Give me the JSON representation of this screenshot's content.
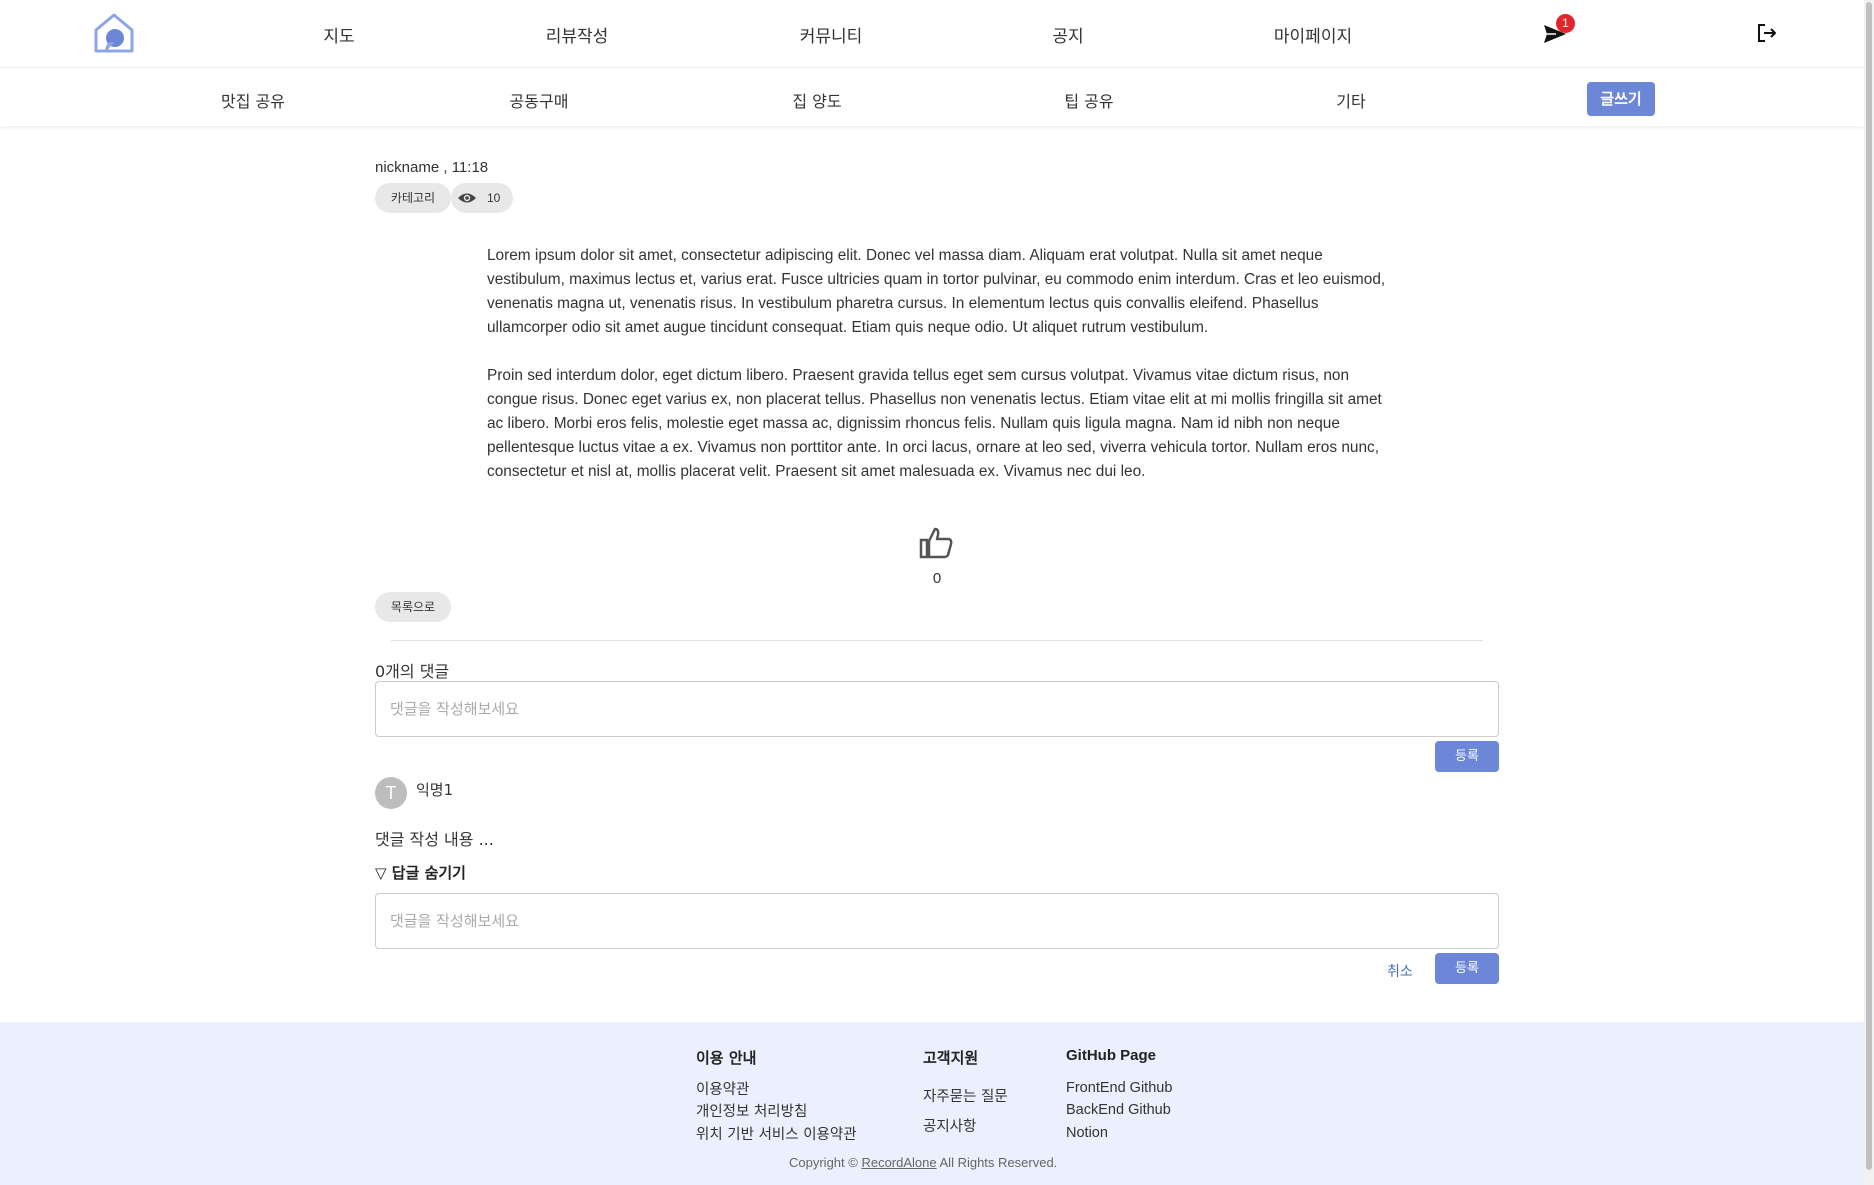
{
  "topnav": {
    "items": [
      {
        "label": "지도"
      },
      {
        "label": "리뷰작성"
      },
      {
        "label": "커뮤니티"
      },
      {
        "label": "공지"
      },
      {
        "label": "마이페이지"
      }
    ],
    "notification_count": "1"
  },
  "subnav": {
    "categories": [
      {
        "label": "맛집 공유"
      },
      {
        "label": "공동구매"
      },
      {
        "label": "집 양도"
      },
      {
        "label": "팁 공유"
      },
      {
        "label": "기타"
      }
    ],
    "write_label": "글쓰기"
  },
  "post": {
    "meta": "nickname , 11:18",
    "category_label": "카테고리",
    "views": "10",
    "paragraphs": [
      "Lorem ipsum dolor sit amet, consectetur adipiscing elit. Donec vel massa diam. Aliquam erat volutpat. Nulla sit amet neque vestibulum, maximus lectus et, varius erat. Fusce ultricies quam in tortor pulvinar, eu commodo enim interdum. Cras et leo euismod, venenatis magna ut, venenatis risus. In vestibulum pharetra cursus. In elementum lectus quis convallis eleifend. Phasellus ullamcorper odio sit amet augue tincidunt consequat. Etiam quis neque odio. Ut aliquet rutrum vestibulum.",
      "Proin sed interdum dolor, eget dictum libero. Praesent gravida tellus eget sem cursus volutpat. Vivamus vitae dictum risus, non congue risus. Donec eget varius ex, non placerat tellus. Phasellus non venenatis lectus. Etiam vitae elit at mi mollis fringilla sit amet ac libero. Morbi eros felis, molestie eget massa ac, dignissim rhoncus felis. Nullam quis ligula magna. Nam id nibh non neque pellentesque luctus vitae a ex. Vivamus non porttitor ante. In orci lacus, ornare at leo sed, viverra vehicula tortor. Nullam eros nunc, consectetur et nisl at, mollis placerat velit. Praesent sit amet malesuada ex. Vivamus nec dui leo."
    ],
    "likes": "0",
    "back_label": "목록으로"
  },
  "comments": {
    "count_label": "0개의 댓글",
    "input_placeholder": "댓글을 작성해보세요",
    "submit_label": "등록",
    "items": [
      {
        "avatar_letter": "T",
        "author": "익명1",
        "text": "댓글 작성 내용 ...",
        "toggle_label": "▽ 답글 숨기기"
      }
    ],
    "reply": {
      "placeholder": "댓글을 작성해보세요",
      "cancel_label": "취소",
      "submit_label": "등록"
    }
  },
  "footer": {
    "sections": [
      {
        "title": "이용 안내",
        "links": [
          "이용약관",
          "개인정보 처리방침",
          "위치 기반 서비스 이용약관"
        ]
      },
      {
        "title": "고객지원",
        "links": [
          "자주묻는 질문",
          "공지사항"
        ]
      },
      {
        "title": "GitHub Page",
        "links": [
          "FrontEnd Github",
          "BackEnd Github",
          "Notion"
        ]
      }
    ],
    "copyright_prefix": "Copyright ©",
    "brand": "RecordAlone",
    "copyright_suffix": "All Rights Reserved."
  },
  "colors": {
    "accent": "#6c86d8",
    "badge": "#e0262c",
    "footer_bg": "#eceffd"
  },
  "icons": [
    "home-logo-icon",
    "send-icon",
    "logout-icon",
    "eye-icon",
    "thumbs-up-icon"
  ]
}
